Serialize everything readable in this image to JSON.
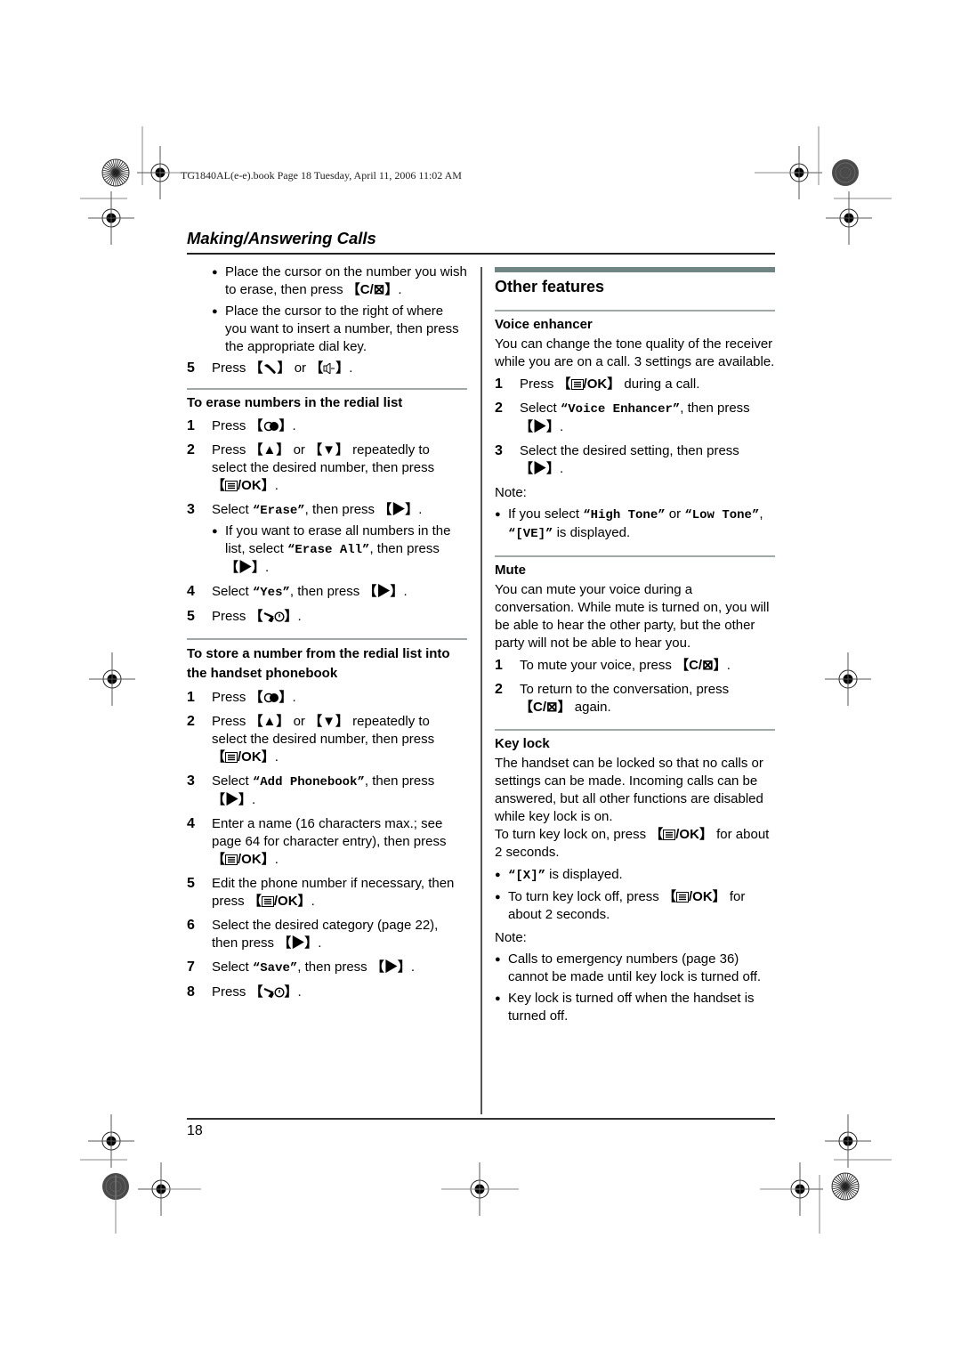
{
  "header": {
    "book_info": "TG1840AL(e-e).book  Page 18  Tuesday, April 11, 2006  11:02 AM",
    "section_title": "Making/Answering Calls"
  },
  "left_column": {
    "intro_bullets": [
      {
        "text": "Place the cursor on the number you wish to erase, then press ",
        "key": "C/⊠",
        "after": "."
      },
      {
        "text": "Place the cursor to the right of where you want to insert a number, then press the appropriate dial key."
      }
    ],
    "step5": {
      "num": "5",
      "pre": "Press ",
      "key1": "talk-icon",
      "mid": " or ",
      "key2": "speaker-icon",
      "after": "."
    },
    "erase_section": {
      "heading": "To erase numbers in the redial list",
      "steps": [
        {
          "num": "1",
          "pre": "Press ",
          "after": "."
        },
        {
          "num": "2",
          "pre": "Press ",
          "mid": " or ",
          "post": " repeatedly to select the desired number, then press ",
          "key": "/OK",
          "after": "."
        },
        {
          "num": "3",
          "pre": "Select ",
          "mono": "“Erase”",
          "post": ", then press ",
          "after": "."
        },
        {
          "num": "4",
          "pre": "Select ",
          "mono": "“Yes”",
          "post": ", then press ",
          "after": "."
        },
        {
          "num": "5",
          "pre": "Press ",
          "after": "."
        }
      ],
      "step3_bullet": {
        "pre": "If you want to erase all numbers in the list, select ",
        "mono": "“Erase All”",
        "post": ", then press ",
        "after": "."
      }
    },
    "store_section": {
      "heading": "To store a number from the redial list into the handset phonebook",
      "steps": [
        {
          "num": "1",
          "pre": "Press ",
          "after": "."
        },
        {
          "num": "2",
          "pre": "Press ",
          "mid": " or ",
          "post": " repeatedly to select the desired number, then press ",
          "key": "/OK",
          "after": "."
        },
        {
          "num": "3",
          "pre": "Select ",
          "mono": "“Add Phonebook”",
          "post": ", then press ",
          "after": "."
        },
        {
          "num": "4",
          "pre": "Enter a name (16 characters max.; see page 64 for character entry), then press ",
          "key": "/OK",
          "after": "."
        },
        {
          "num": "5",
          "pre": "Edit the phone number if necessary, then press ",
          "key": "/OK",
          "after": "."
        },
        {
          "num": "6",
          "pre": "Select the desired category (page 22), then press ",
          "after": "."
        },
        {
          "num": "7",
          "pre": "Select ",
          "mono": "“Save”",
          "post": ", then press ",
          "after": "."
        },
        {
          "num": "8",
          "pre": "Press ",
          "after": "."
        }
      ]
    }
  },
  "right_column": {
    "title": "Other features",
    "voice_enhancer": {
      "heading": "Voice enhancer",
      "body": "You can change the tone quality of the receiver while you are on a call. 3 settings are available.",
      "steps": [
        {
          "num": "1",
          "pre": "Press ",
          "key": "/OK",
          "post": " during a call."
        },
        {
          "num": "2",
          "pre": "Select ",
          "mono": "“Voice Enhancer”",
          "post": ", then press ",
          "after": "."
        },
        {
          "num": "3",
          "pre": "Select the desired setting, then press ",
          "after": "."
        }
      ],
      "note_label": "Note:",
      "note": {
        "pre": "If you select ",
        "mono1": "“High Tone”",
        "mid": " or ",
        "mono2": "“Low Tone”",
        "mid2": ", ",
        "mono3": "“[VE]”",
        "post": " is displayed."
      }
    },
    "mute": {
      "heading": "Mute",
      "body": "You can mute your voice during a conversation. While mute is turned on, you will be able to hear the other party, but the other party will not be able to hear you.",
      "steps": [
        {
          "num": "1",
          "pre": "To mute your voice, press ",
          "key": "C/⊠",
          "after": "."
        },
        {
          "num": "2",
          "pre": "To return to the conversation, press ",
          "key": "C/⊠",
          "post": " again."
        }
      ]
    },
    "key_lock": {
      "heading": "Key lock",
      "body": "The handset can be locked so that no calls or settings can be made. Incoming calls can be answered, but all other functions are disabled while key lock is on.",
      "on_pre": "To turn key lock on, press ",
      "on_key": "/OK",
      "on_post": " for about 2 seconds.",
      "bullets": [
        {
          "mono": "“[X]”",
          "post": " is displayed."
        },
        {
          "pre": "To turn key lock off, press ",
          "key": "/OK",
          "post": " for about 2 seconds."
        }
      ],
      "note_label": "Note:",
      "notes": [
        "Calls to emergency numbers (page 36) cannot be made until key lock is turned off.",
        "Key lock is turned off when the handset is turned off."
      ]
    }
  },
  "footer": {
    "page_number": "18"
  },
  "colors": {
    "feature_bar": "#6f8583",
    "sub_rule": "#a0a8a8",
    "text": "#000000"
  }
}
